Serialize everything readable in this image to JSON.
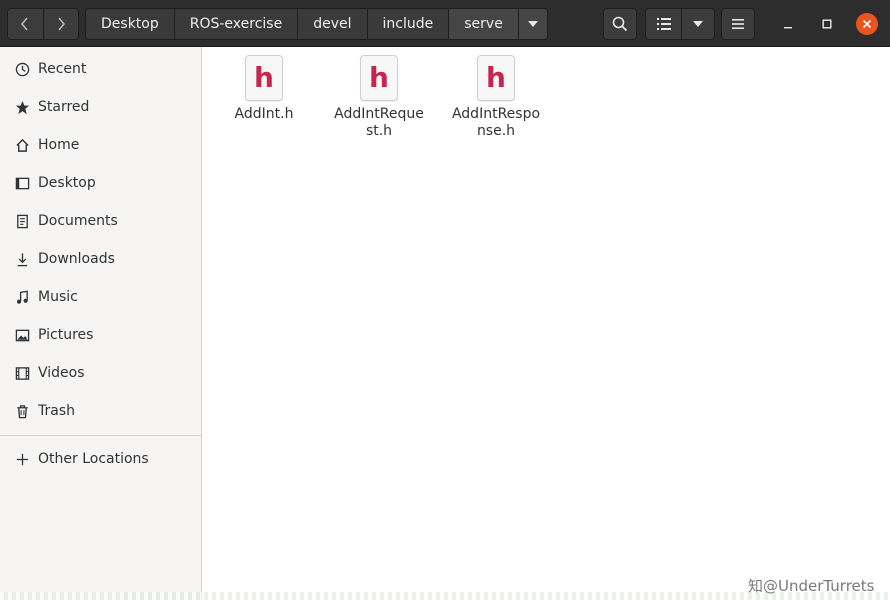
{
  "header": {
    "breadcrumbs": [
      {
        "label": "Desktop"
      },
      {
        "label": "ROS-exercise"
      },
      {
        "label": "devel"
      },
      {
        "label": "include"
      },
      {
        "label": "serve"
      }
    ]
  },
  "sidebar": {
    "items": [
      {
        "label": "Recent",
        "icon": "clock-icon"
      },
      {
        "label": "Starred",
        "icon": "star-icon"
      },
      {
        "label": "Home",
        "icon": "home-icon"
      },
      {
        "label": "Desktop",
        "icon": "desktop-icon"
      },
      {
        "label": "Documents",
        "icon": "document-icon"
      },
      {
        "label": "Downloads",
        "icon": "download-icon"
      },
      {
        "label": "Music",
        "icon": "music-icon"
      },
      {
        "label": "Pictures",
        "icon": "picture-icon"
      },
      {
        "label": "Videos",
        "icon": "video-icon"
      },
      {
        "label": "Trash",
        "icon": "trash-icon"
      }
    ],
    "other_locations": "Other Locations"
  },
  "files": [
    {
      "name": "AddInt.h",
      "icon_letter": "h"
    },
    {
      "name": "AddIntRequest.h",
      "icon_letter": "h"
    },
    {
      "name": "AddIntResponse.h",
      "icon_letter": "h"
    }
  ],
  "watermark": "知@UnderTurrets",
  "colors": {
    "header": "#2d2d2d",
    "close": "#e95420",
    "file_icon_letter": "#c7254e"
  }
}
